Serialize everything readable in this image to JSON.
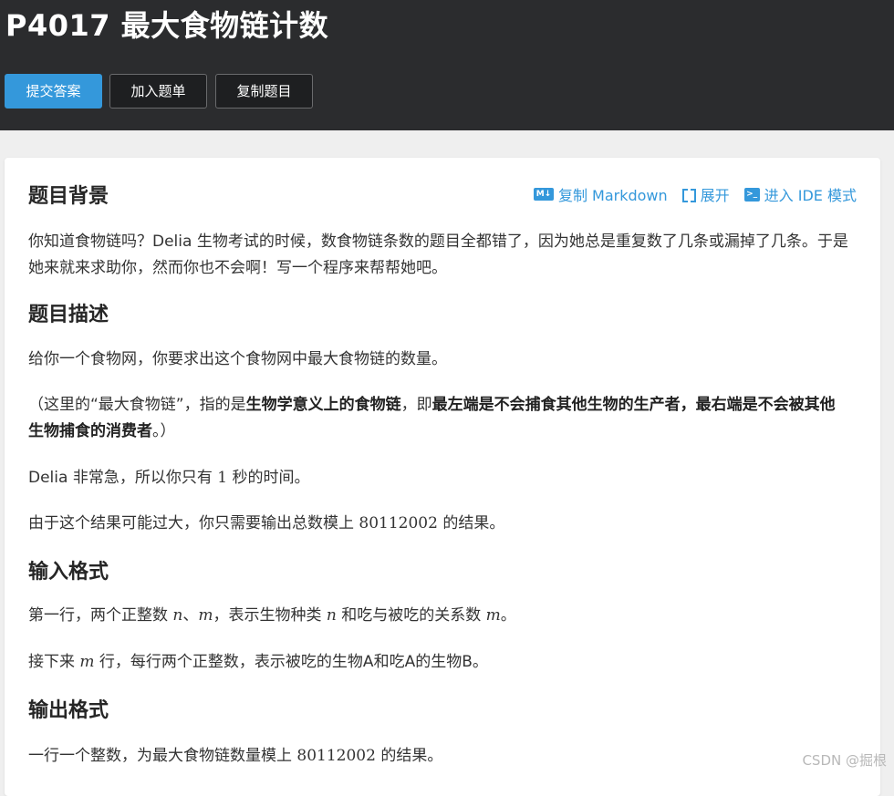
{
  "header": {
    "title": "P4017 最大食物链计数",
    "buttons": {
      "submit": "提交答案",
      "add_to_list": "加入题单",
      "copy_problem": "复制题目"
    }
  },
  "toolbar": {
    "copy_markdown": "复制 Markdown",
    "expand": "展开",
    "ide_mode": "进入 IDE 模式"
  },
  "sections": {
    "background": {
      "heading": "题目背景",
      "text": "你知道食物链吗？Delia 生物考试的时候，数食物链条数的题目全都错了，因为她总是重复数了几条或漏掉了几条。于是她来就来求助你，然而你也不会啊！写一个程序来帮帮她吧。"
    },
    "description": {
      "heading": "题目描述",
      "p1": "给你一个食物网，你要求出这个食物网中最大食物链的数量。",
      "p2_parts": {
        "a": "（这里的“最大食物链”，指的是",
        "b": "生物学意义上的食物链",
        "c": "，即",
        "d": "最左端是不会捕食其他生物的生产者，最右端是不会被其他生物捕食的消费者",
        "e": "。）"
      },
      "p3_parts": {
        "a": "Delia 非常急，所以你只有 ",
        "n": "1",
        "b": " 秒的时间。"
      },
      "p4_parts": {
        "a": "由于这个结果可能过大，你只需要输出总数模上 ",
        "n": "80112002",
        "b": " 的结果。"
      }
    },
    "input": {
      "heading": "输入格式",
      "p1_parts": {
        "a": "第一行，两个正整数 ",
        "n": "n",
        "sep": "、",
        "m": "m",
        "b": "，表示生物种类 ",
        "n2": "n",
        "c": " 和吃与被吃的关系数 ",
        "m2": "m",
        "d": "。"
      },
      "p2_parts": {
        "a": "接下来 ",
        "m": "m",
        "b": " 行，每行两个正整数，表示被吃的生物A和吃A的生物B。"
      }
    },
    "output": {
      "heading": "输出格式",
      "p1_parts": {
        "a": "一行一个整数，为最大食物链数量模上 ",
        "n": "80112002",
        "b": " 的结果。"
      }
    }
  },
  "watermark": "CSDN @掘根",
  "icons": {
    "markdown": "markdown-icon",
    "expand": "expand-icon",
    "ide": "terminal-icon"
  },
  "colors": {
    "accent": "#3498db",
    "header_bg": "#2b2c2e"
  }
}
